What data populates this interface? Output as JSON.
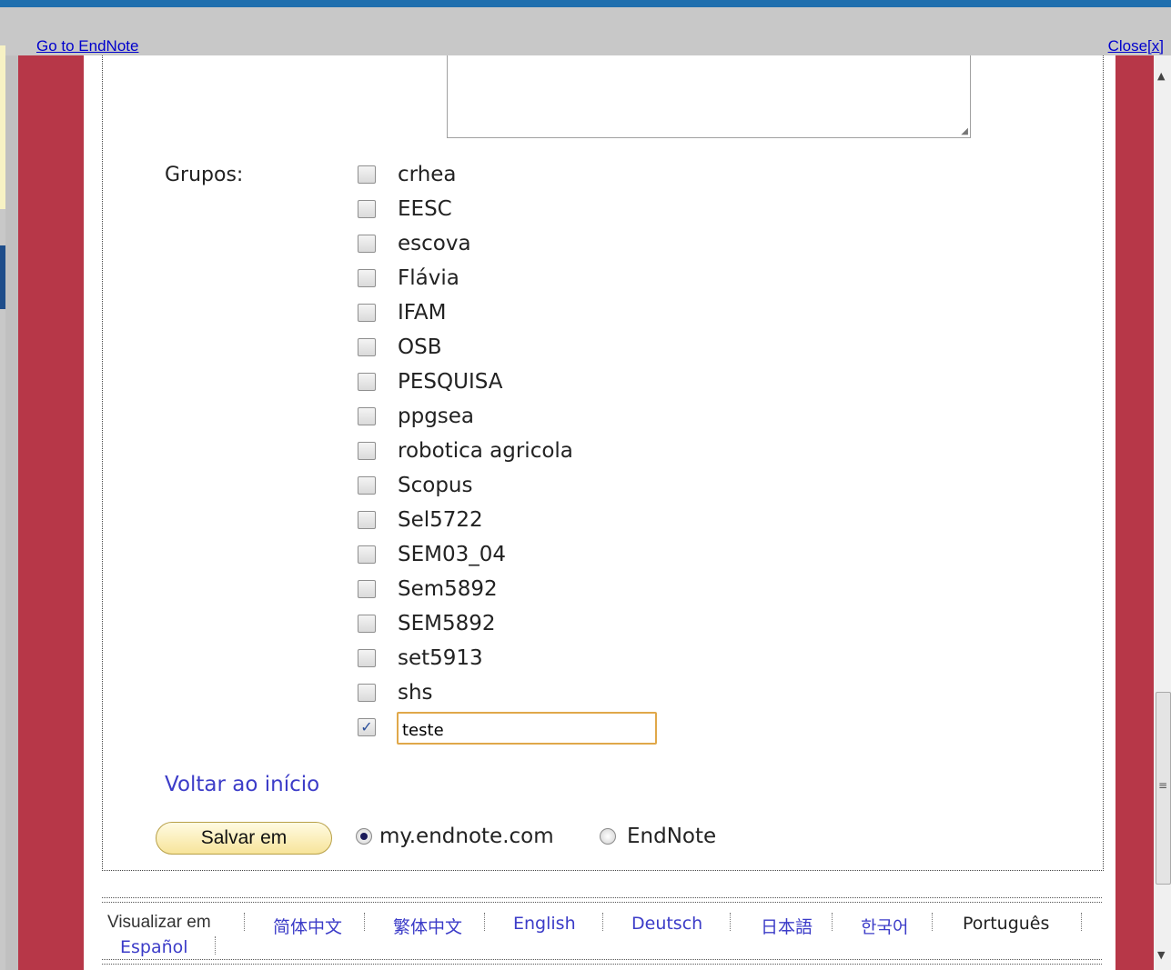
{
  "header": {
    "goto_label": "Go to EndNote",
    "close_label": "Close[x]"
  },
  "groups_label": "Grupos:",
  "groups": [
    {
      "label": "crhea",
      "checked": false
    },
    {
      "label": "EESC",
      "checked": false
    },
    {
      "label": "escova",
      "checked": false
    },
    {
      "label": "Flávia",
      "checked": false
    },
    {
      "label": "IFAM",
      "checked": false
    },
    {
      "label": "OSB",
      "checked": false
    },
    {
      "label": "PESQUISA",
      "checked": false
    },
    {
      "label": "ppgsea",
      "checked": false
    },
    {
      "label": "robotica agricola",
      "checked": false
    },
    {
      "label": "Scopus",
      "checked": false
    },
    {
      "label": "Sel5722",
      "checked": false
    },
    {
      "label": "SEM03_04",
      "checked": false
    },
    {
      "label": "Sem5892",
      "checked": false
    },
    {
      "label": "SEM5892",
      "checked": false
    },
    {
      "label": "set5913",
      "checked": false
    },
    {
      "label": "shs",
      "checked": false
    }
  ],
  "new_group": {
    "checked": true,
    "value": "teste"
  },
  "back_link": "Voltar ao início",
  "save": {
    "button_label": "Salvar em",
    "options": [
      {
        "label": "my.endnote.com",
        "selected": true
      },
      {
        "label": "EndNote",
        "selected": false
      }
    ]
  },
  "footer": {
    "view_label": "Visualizar em",
    "languages": [
      "简体中文",
      "繁体中文",
      "English",
      "Deutsch",
      "日本語",
      "한국어",
      "Português",
      "Español"
    ],
    "current_language": "Português"
  },
  "colors": {
    "accent_red": "#b73748",
    "link_blue": "#3c3cc8",
    "focus_orange": "#e0a84a"
  }
}
